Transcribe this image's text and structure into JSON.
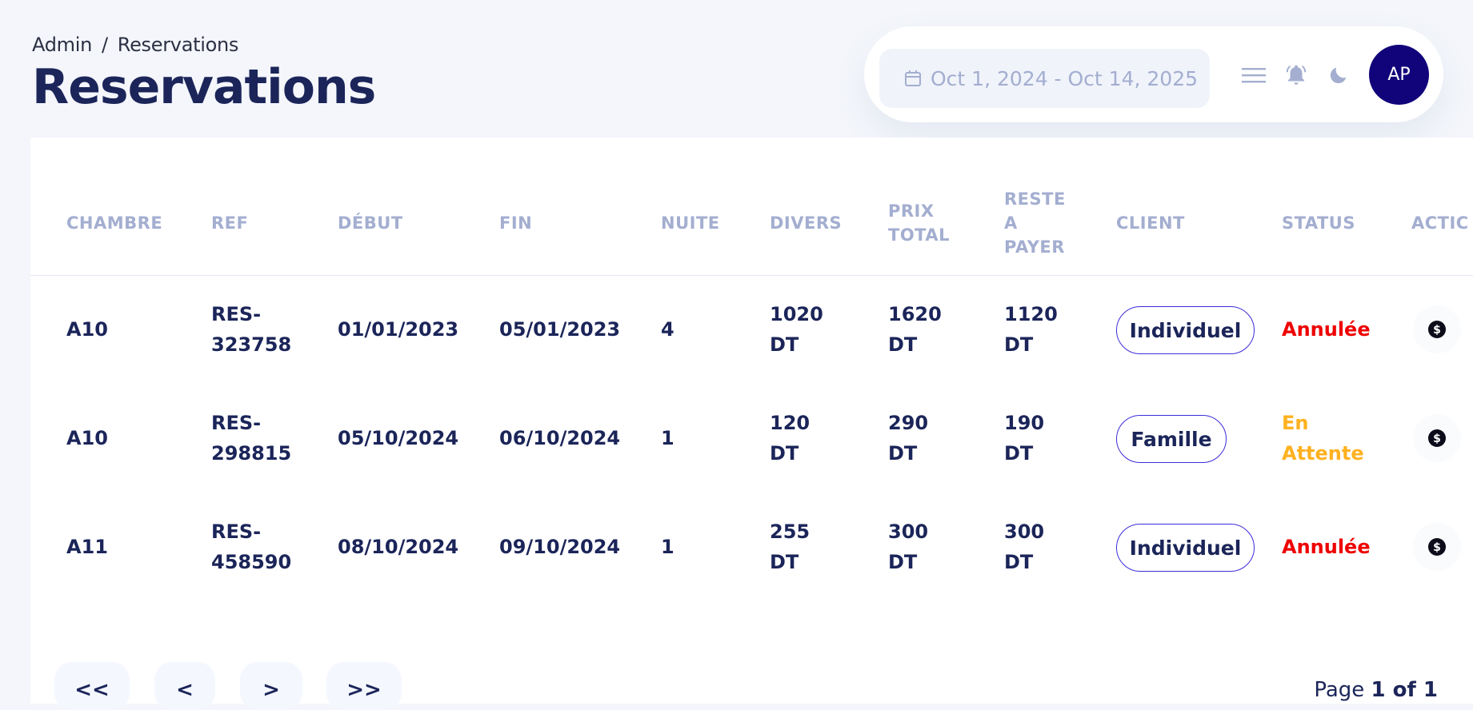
{
  "breadcrumb": {
    "root": "Admin",
    "separator": "/",
    "current": "Reservations"
  },
  "page_title": "Reservations",
  "toolbar": {
    "date_range": "Oct 1, 2024 - Oct 14, 2025",
    "menu_icon": "menu-icon",
    "notification_icon": "bell-icon",
    "theme_icon": "moon-icon",
    "avatar_initials": "AP",
    "avatar_color": "#11047a"
  },
  "table": {
    "headers": {
      "chambre": "CHAMBRE",
      "ref": "REF",
      "debut": "DÉBUT",
      "fin": "FIN",
      "nuite": "NUITE",
      "divers": "DIVERS",
      "prix_total_1": "PRIX",
      "prix_total_2": "TOTAL",
      "reste_1": "RESTE",
      "reste_2": "A",
      "reste_3": "PAYER",
      "client": "CLIENT",
      "status": "STATUS",
      "action": "ACTIC"
    },
    "rows": [
      {
        "chambre": "A10",
        "ref_1": "RES-",
        "ref_2": "323758",
        "debut": "01/01/2023",
        "fin": "05/01/2023",
        "nuite": "4",
        "divers_1": "1020",
        "divers_2": "DT",
        "prix_1": "1620",
        "prix_2": "DT",
        "reste_1": "1120",
        "reste_2": "DT",
        "client": "Individuel",
        "status_1": "Annulée",
        "status_2": "",
        "status_color": "#ee0000"
      },
      {
        "chambre": "A10",
        "ref_1": "RES-",
        "ref_2": "298815",
        "debut": "05/10/2024",
        "fin": "06/10/2024",
        "nuite": "1",
        "divers_1": "120",
        "divers_2": "DT",
        "prix_1": "290",
        "prix_2": "DT",
        "reste_1": "190",
        "reste_2": "DT",
        "client": "Famille",
        "status_1": "En",
        "status_2": "Attente",
        "status_color": "#ffb11f"
      },
      {
        "chambre": "A11",
        "ref_1": "RES-",
        "ref_2": "458590",
        "debut": "08/10/2024",
        "fin": "09/10/2024",
        "nuite": "1",
        "divers_1": "255",
        "divers_2": "DT",
        "prix_1": "300",
        "prix_2": "DT",
        "reste_1": "300",
        "reste_2": "DT",
        "client": "Individuel",
        "status_1": "Annulée",
        "status_2": "",
        "status_color": "#ee0000"
      }
    ],
    "action_icon": "dollar-coin-icon"
  },
  "pagination": {
    "first": "<<",
    "prev": "<",
    "next": ">",
    "last": ">>",
    "page_prefix": "Page",
    "page_value": "1 of 1"
  }
}
